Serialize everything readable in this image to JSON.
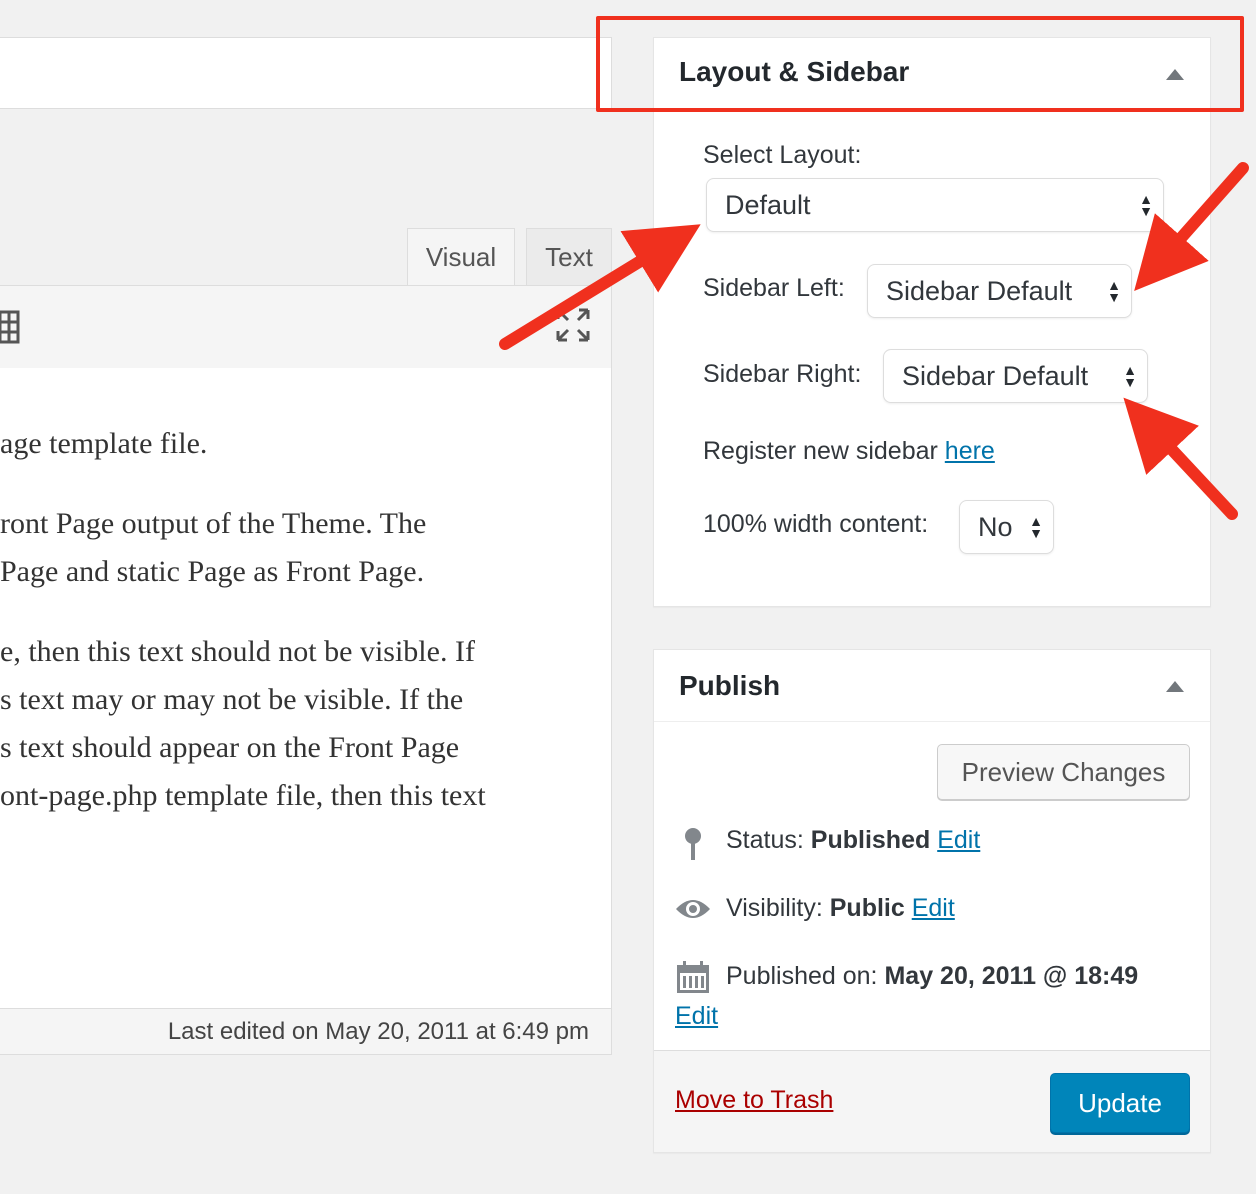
{
  "editor": {
    "tabs": {
      "visual": "Visual",
      "text": "Text"
    },
    "content_lines": [
      "age template file.",
      "ront Page output of the Theme. The",
      "Page and static Page as Front Page.",
      "e, then this text should not be visible. If",
      "s text may or may not be visible. If the",
      "s text should appear on the Front Page",
      "ont-page.php template file, then this text"
    ],
    "last_edited": "Last edited on May 20, 2011 at 6:49 pm"
  },
  "layout_box": {
    "title": "Layout & Sidebar",
    "select_layout_label": "Select Layout:",
    "select_layout_value": "Default",
    "sidebar_left_label": "Sidebar Left:",
    "sidebar_left_value": "Sidebar Default",
    "sidebar_right_label": "Sidebar Right:",
    "sidebar_right_value": "Sidebar Default",
    "register_text": "Register new sidebar",
    "register_link": "here",
    "full_width_label": "100% width content:",
    "full_width_value": "No"
  },
  "publish_box": {
    "title": "Publish",
    "preview_button": "Preview Changes",
    "status_label": "Status:",
    "status_value": "Published",
    "visibility_label": "Visibility:",
    "visibility_value": "Public",
    "published_label": "Published on:",
    "published_value": "May 20, 2011 @ 18:49",
    "edit_link": "Edit",
    "trash_link": "Move to Trash",
    "update_button": "Update"
  },
  "colors": {
    "annotation_red": "#f0301e",
    "link_blue": "#0073aa",
    "trash_red": "#a00",
    "update_blue": "#0085ba"
  },
  "icons": [
    "fullscreen-icon",
    "kitchen-sink-icon",
    "pin-icon",
    "eye-icon",
    "calendar-icon",
    "up-arrow-icon"
  ]
}
